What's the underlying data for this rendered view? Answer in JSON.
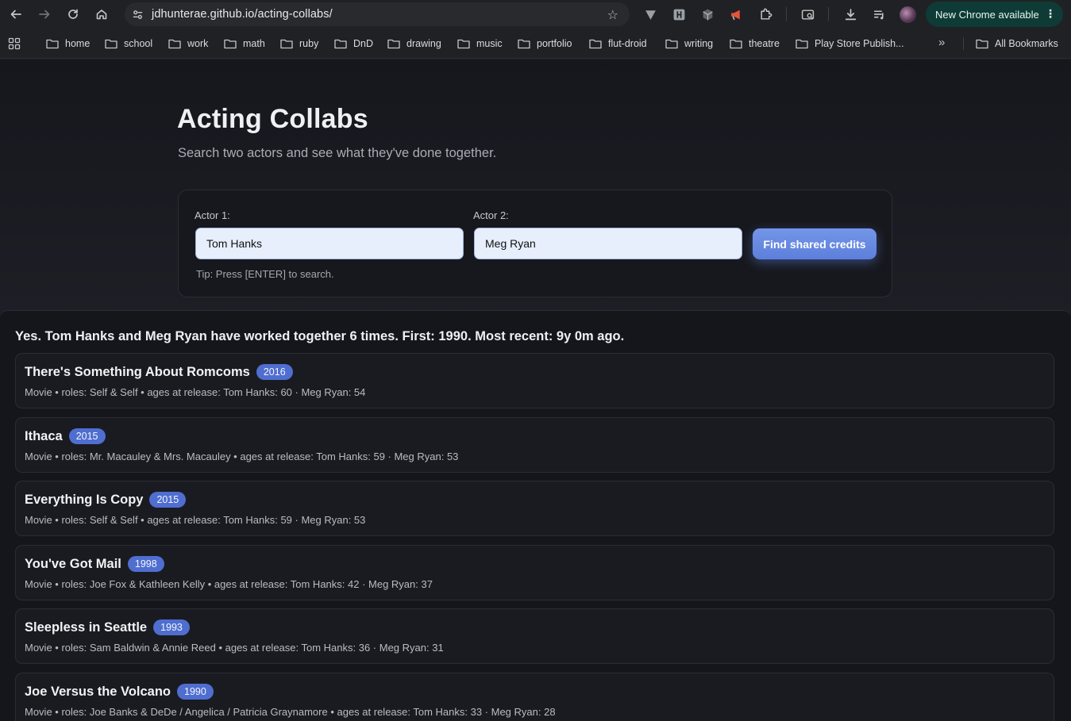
{
  "browser": {
    "url": "jdhunterae.github.io/acting-collabs/",
    "update_label": "New Chrome available",
    "bookmarks": [
      "home",
      "school",
      "work",
      "math",
      "ruby",
      "DnD",
      "drawing",
      "music",
      "portfolio",
      "flut-droid",
      "writing",
      "theatre",
      "Play Store Publish..."
    ],
    "all_bookmarks_label": "All Bookmarks"
  },
  "page": {
    "title": "Acting Collabs",
    "subtitle": "Search two actors and see what they've done together.",
    "actor1_label": "Actor 1:",
    "actor1_value": "Tom Hanks",
    "actor2_label": "Actor 2:",
    "actor2_value": "Meg Ryan",
    "find_button": "Find shared credits",
    "tip": "Tip: Press [ENTER] to search."
  },
  "summary": {
    "lead": "Yes.",
    "text": "Tom Hanks and Meg Ryan have worked together 6 times. First: 1990. Most recent: 9y 0m ago."
  },
  "credits": [
    {
      "title": "There's Something About Romcoms",
      "year": "2016",
      "meta": "Movie • roles: Self & Self • ages at release: Tom Hanks: 60 · Meg Ryan: 54"
    },
    {
      "title": "Ithaca",
      "year": "2015",
      "meta": "Movie • roles: Mr. Macauley & Mrs. Macauley • ages at release: Tom Hanks: 59 · Meg Ryan: 53"
    },
    {
      "title": "Everything Is Copy",
      "year": "2015",
      "meta": "Movie • roles: Self & Self • ages at release: Tom Hanks: 59 · Meg Ryan: 53"
    },
    {
      "title": "You've Got Mail",
      "year": "1998",
      "meta": "Movie • roles: Joe Fox & Kathleen Kelly • ages at release: Tom Hanks: 42 · Meg Ryan: 37"
    },
    {
      "title": "Sleepless in Seattle",
      "year": "1993",
      "meta": "Movie • roles: Sam Baldwin & Annie Reed • ages at release: Tom Hanks: 36 · Meg Ryan: 31"
    },
    {
      "title": "Joe Versus the Volcano",
      "year": "1990",
      "meta": "Movie • roles: Joe Banks & DeDe / Angelica / Patricia Graynamore • ages at release: Tom Hanks: 33 · Meg Ryan: 28"
    }
  ]
}
